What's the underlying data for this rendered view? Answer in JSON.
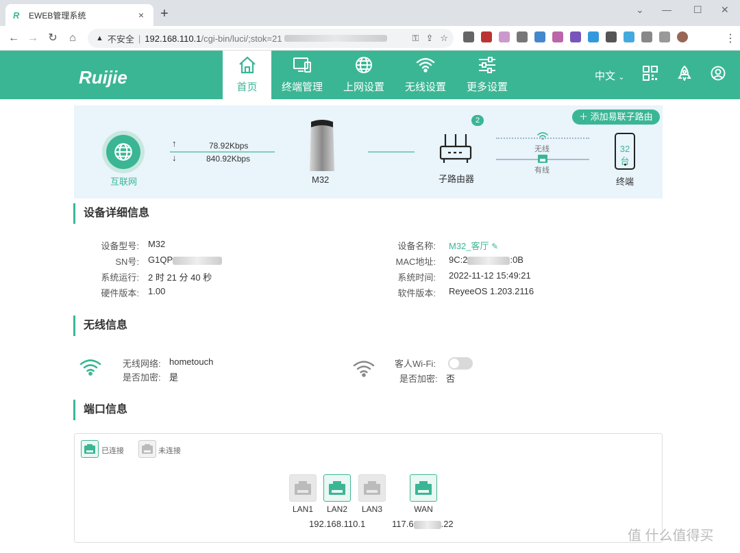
{
  "browser": {
    "tab_title": "EWEB管理系统",
    "tab_close": "×",
    "new_tab": "+",
    "insecure_label": "不安全",
    "url_host": "192.168.110.1",
    "url_path": "/cgi-bin/luci/;stok=",
    "url_tail": "21"
  },
  "app": {
    "logo": "Ruijie",
    "nav": [
      {
        "label": "首页"
      },
      {
        "label": "终端管理"
      },
      {
        "label": "上网设置"
      },
      {
        "label": "无线设置"
      },
      {
        "label": "更多设置"
      }
    ],
    "language": "中文",
    "accent": "#3bb695"
  },
  "topology": {
    "internet_label": "互联网",
    "upload": "78.92Kbps",
    "download": "840.92Kbps",
    "device_label": "M32",
    "router_label": "子路由器",
    "router_count": "2",
    "wireless_label": "无线",
    "wired_label": "有线",
    "terminal_count": "32台",
    "terminal_label": "终端",
    "add_button": "添加易联子路由"
  },
  "device_info": {
    "title": "设备详细信息",
    "left": [
      {
        "label": "设备型号:",
        "value": "M32"
      },
      {
        "label": "SN号:",
        "value": "G1QP"
      },
      {
        "label": "系统运行:",
        "value": "2 时 21 分 40 秒"
      },
      {
        "label": "硬件版本:",
        "value": "1.00"
      }
    ],
    "right": [
      {
        "label": "设备名称:",
        "value": "M32_客厅"
      },
      {
        "label": "MAC地址:",
        "value": "9C:2",
        "value_tail": ":0B"
      },
      {
        "label": "系统时间:",
        "value": "2022-11-12 15:49:21"
      },
      {
        "label": "软件版本:",
        "value": "ReyeeOS 1.203.2116"
      }
    ]
  },
  "wireless_info": {
    "title": "无线信息",
    "ssid_label": "无线网络:",
    "ssid": "hometouch",
    "encrypt_label": "是否加密:",
    "encrypt": "是",
    "guest_label": "客人Wi-Fi:",
    "guest_encrypt_label": "是否加密:",
    "guest_encrypt": "否"
  },
  "port_info": {
    "title": "端口信息",
    "legend_connected": "已连接",
    "legend_disconnected": "未连接",
    "ports": [
      {
        "name": "LAN1",
        "connected": false
      },
      {
        "name": "LAN2",
        "connected": true
      },
      {
        "name": "LAN3",
        "connected": false
      },
      {
        "name": "WAN",
        "connected": true
      }
    ],
    "lan_ip": "192.168.110.1",
    "wan_ip_head": "117.6",
    "wan_ip_tail": ".22"
  },
  "watermark": "值 什么值得买"
}
